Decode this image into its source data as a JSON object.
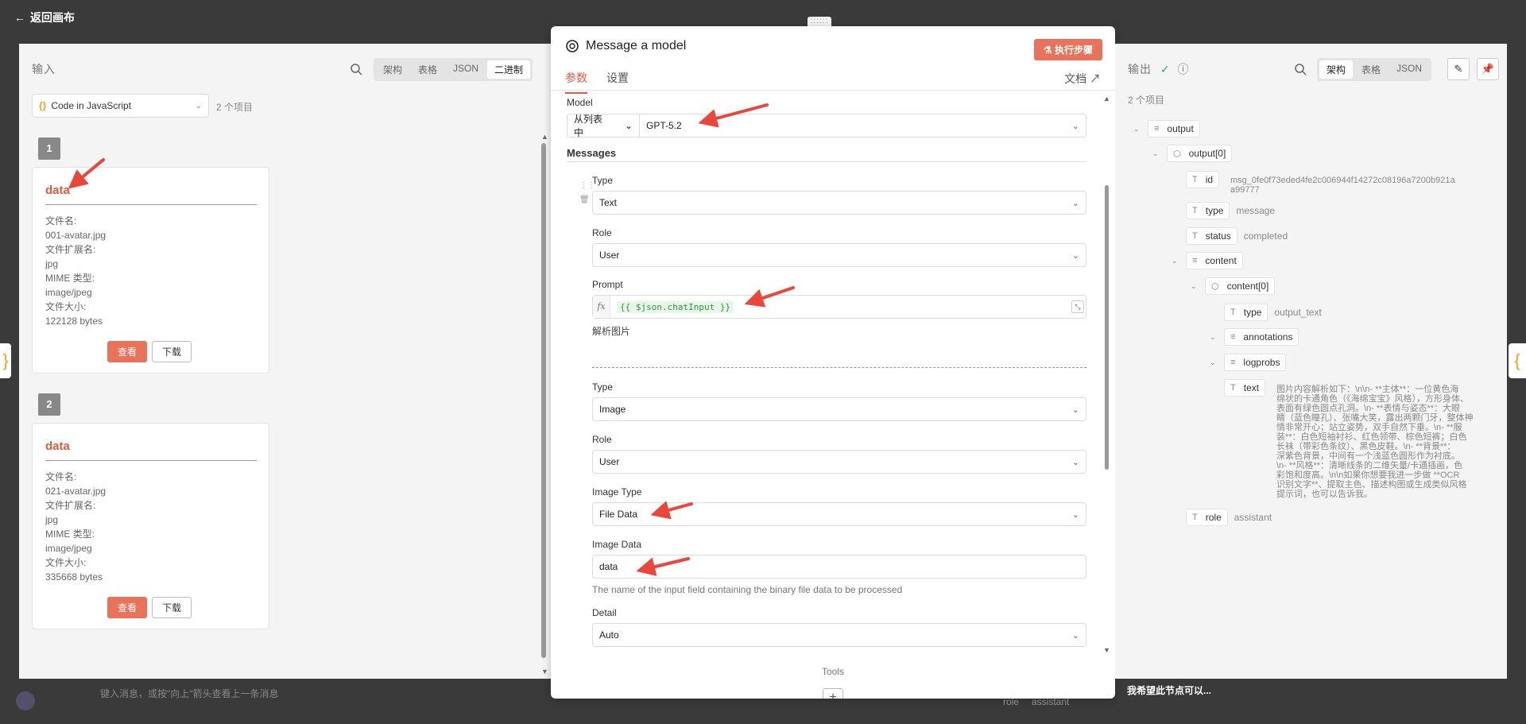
{
  "topbar": {
    "back_label": "返回画布"
  },
  "input": {
    "title": "输入",
    "tabs": [
      "架构",
      "表格",
      "JSON",
      "二进制"
    ],
    "active_tab": "二进制",
    "node_select": "Code in JavaScript",
    "item_count": "2 个项目",
    "items": [
      {
        "index": "1",
        "property": "data",
        "meta": [
          "文件名:",
          "001-avatar.jpg",
          "文件扩展名:",
          "jpg",
          "MIME 类型:",
          "image/jpeg",
          "文件大小:",
          "122128 bytes"
        ],
        "view_label": "查看",
        "download_label": "下载"
      },
      {
        "index": "2",
        "property": "data",
        "meta": [
          "文件名:",
          "021-avatar.jpg",
          "文件扩展名:",
          "jpg",
          "MIME 类型:",
          "image/jpeg",
          "文件大小:",
          "335668 bytes"
        ],
        "view_label": "查看",
        "download_label": "下载"
      }
    ]
  },
  "node": {
    "title": "Message a model",
    "execute_label": "执行步骤",
    "tabs": [
      "参数",
      "设置"
    ],
    "active_tab": "参数",
    "docs_label": "文档",
    "model_label": "Model",
    "model_mode": "从列表中",
    "model_value": "GPT-5.2",
    "messages_label": "Messages",
    "msg1": {
      "type_label": "Type",
      "type_value": "Text",
      "role_label": "Role",
      "role_value": "User",
      "prompt_label": "Prompt",
      "prompt_fx": "fx",
      "prompt_expr": "{{ $json.chatInput }}",
      "prompt_result": "解析图片"
    },
    "msg2": {
      "type_label": "Type",
      "type_value": "Image",
      "role_label": "Role",
      "role_value": "User",
      "image_type_label": "Image Type",
      "image_type_value": "File Data",
      "image_data_label": "Image Data",
      "image_data_value": "data",
      "image_data_hint": "The name of the input field containing the binary file data to be processed",
      "detail_label": "Detail",
      "detail_value": "Auto"
    },
    "tools_label": "Tools",
    "add_label": "+"
  },
  "output": {
    "title": "输出",
    "tabs": [
      "架构",
      "表格",
      "JSON"
    ],
    "active_tab": "架构",
    "item_count": "2 个项目",
    "tree": {
      "output": "output",
      "output0": "output[0]",
      "id_key": "id",
      "id_val_1": "msg_0fe0f73eded4fe2c006944f14272c08196a7200b921a",
      "id_val_2": "a99777",
      "type_key": "type",
      "type_val": "message",
      "status_key": "status",
      "status_val": "completed",
      "content": "content",
      "content0": "content[0]",
      "ctype_key": "type",
      "ctype_val": "output_text",
      "annotations": "annotations",
      "logprobs": "logprobs",
      "text_key": "text",
      "text_lines": [
        "图片内容解析如下：\\n\\n- **主体**：一位黄色海",
        "绵状的卡通角色（《海绵宝宝》风格），方形身体、",
        "表面有绿色圆点孔洞。\\n- **表情与姿态**：大眼",
        "睛（蓝色瞳孔）、张嘴大笑，露出两颗门牙，整体神",
        "情非常开心；站立姿势，双手自然下垂。\\n- **服",
        "装**：白色短袖衬衫、红色领带、棕色短裤；白色",
        "长袜（带彩色条纹）、黑色皮鞋。\\n- **背景**：",
        "深紫色背景，中间有一个浅蓝色圆形作为衬底。",
        "\\n- **风格**：清晰线条的二维矢量/卡通插画，色",
        "彩饱和度高。\\n\\n如果你想要我进一步做 **OCR",
        "识别文字**、提取主色、描述构图或生成类似风格",
        "提示词，也可以告诉我。"
      ],
      "role_key": "role",
      "role_val": "assistant"
    }
  },
  "background": {
    "chat_placeholder": "键入消息，或按\"向上\"箭头查看上一条消息",
    "wish_label": "我希望此节点可以...",
    "role_key": "role",
    "role_val": "assistant"
  },
  "colors": {
    "accent": "#e8735a",
    "success": "#3aa35c",
    "expression": "#2a9d3a"
  }
}
